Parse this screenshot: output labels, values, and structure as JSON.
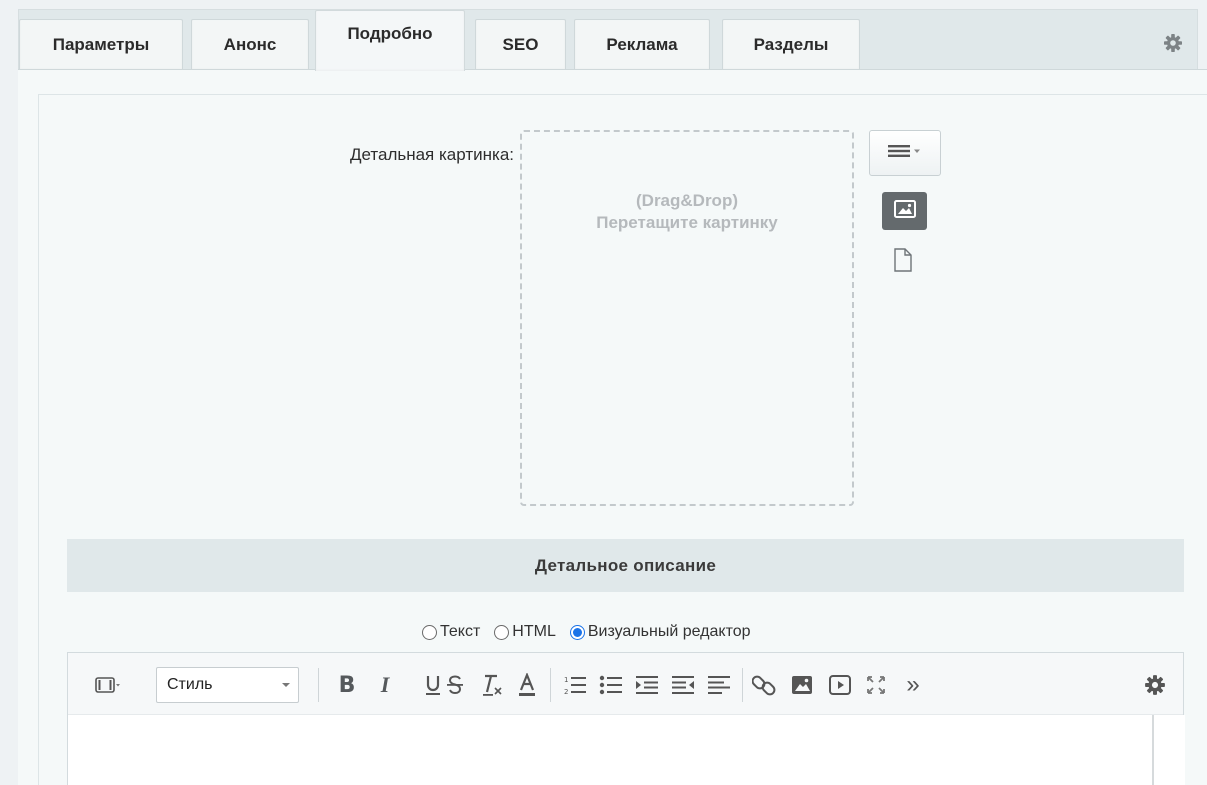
{
  "tabs": [
    {
      "label": "Параметры",
      "active": false
    },
    {
      "label": "Анонс",
      "active": false
    },
    {
      "label": "Подробно",
      "active": true
    },
    {
      "label": "SEO",
      "active": false
    },
    {
      "label": "Реклама",
      "active": false
    },
    {
      "label": "Разделы",
      "active": false
    }
  ],
  "settings_icon": "gear-icon",
  "detail_picture": {
    "label": "Детальная картинка:",
    "drop_line1": "(Drag&Drop)",
    "drop_line2": "Перетащите картинку",
    "menu_icon": "hamburger-dropdown-icon",
    "image_icon": "image-icon",
    "file_icon": "file-icon"
  },
  "detail_description": {
    "header": "Детальное описание",
    "modes": [
      {
        "label": "Текст",
        "checked": false
      },
      {
        "label": "HTML",
        "checked": false
      },
      {
        "label": "Визуальный редактор",
        "checked": true
      }
    ]
  },
  "editor": {
    "style_select_value": "Стиль",
    "toolbar_icons": [
      "film-strip-icon",
      "bold-icon",
      "italic-icon",
      "underline-icon",
      "strikethrough-icon",
      "remove-format-icon",
      "font-color-icon",
      "ordered-list-icon",
      "unordered-list-icon",
      "indent-icon",
      "outdent-icon",
      "align-icon",
      "link-icon",
      "insert-image-icon",
      "video-icon",
      "fullscreen-icon",
      "more-icon",
      "editor-settings-icon"
    ],
    "bold_glyph": "B",
    "italic_glyph": "I",
    "underline_glyph": "U",
    "more_glyph": "»"
  },
  "colors": {
    "accent_radio": "#1a73e8",
    "tab_bar": "#e0e8ea",
    "section_header": "#e0e8ea"
  }
}
